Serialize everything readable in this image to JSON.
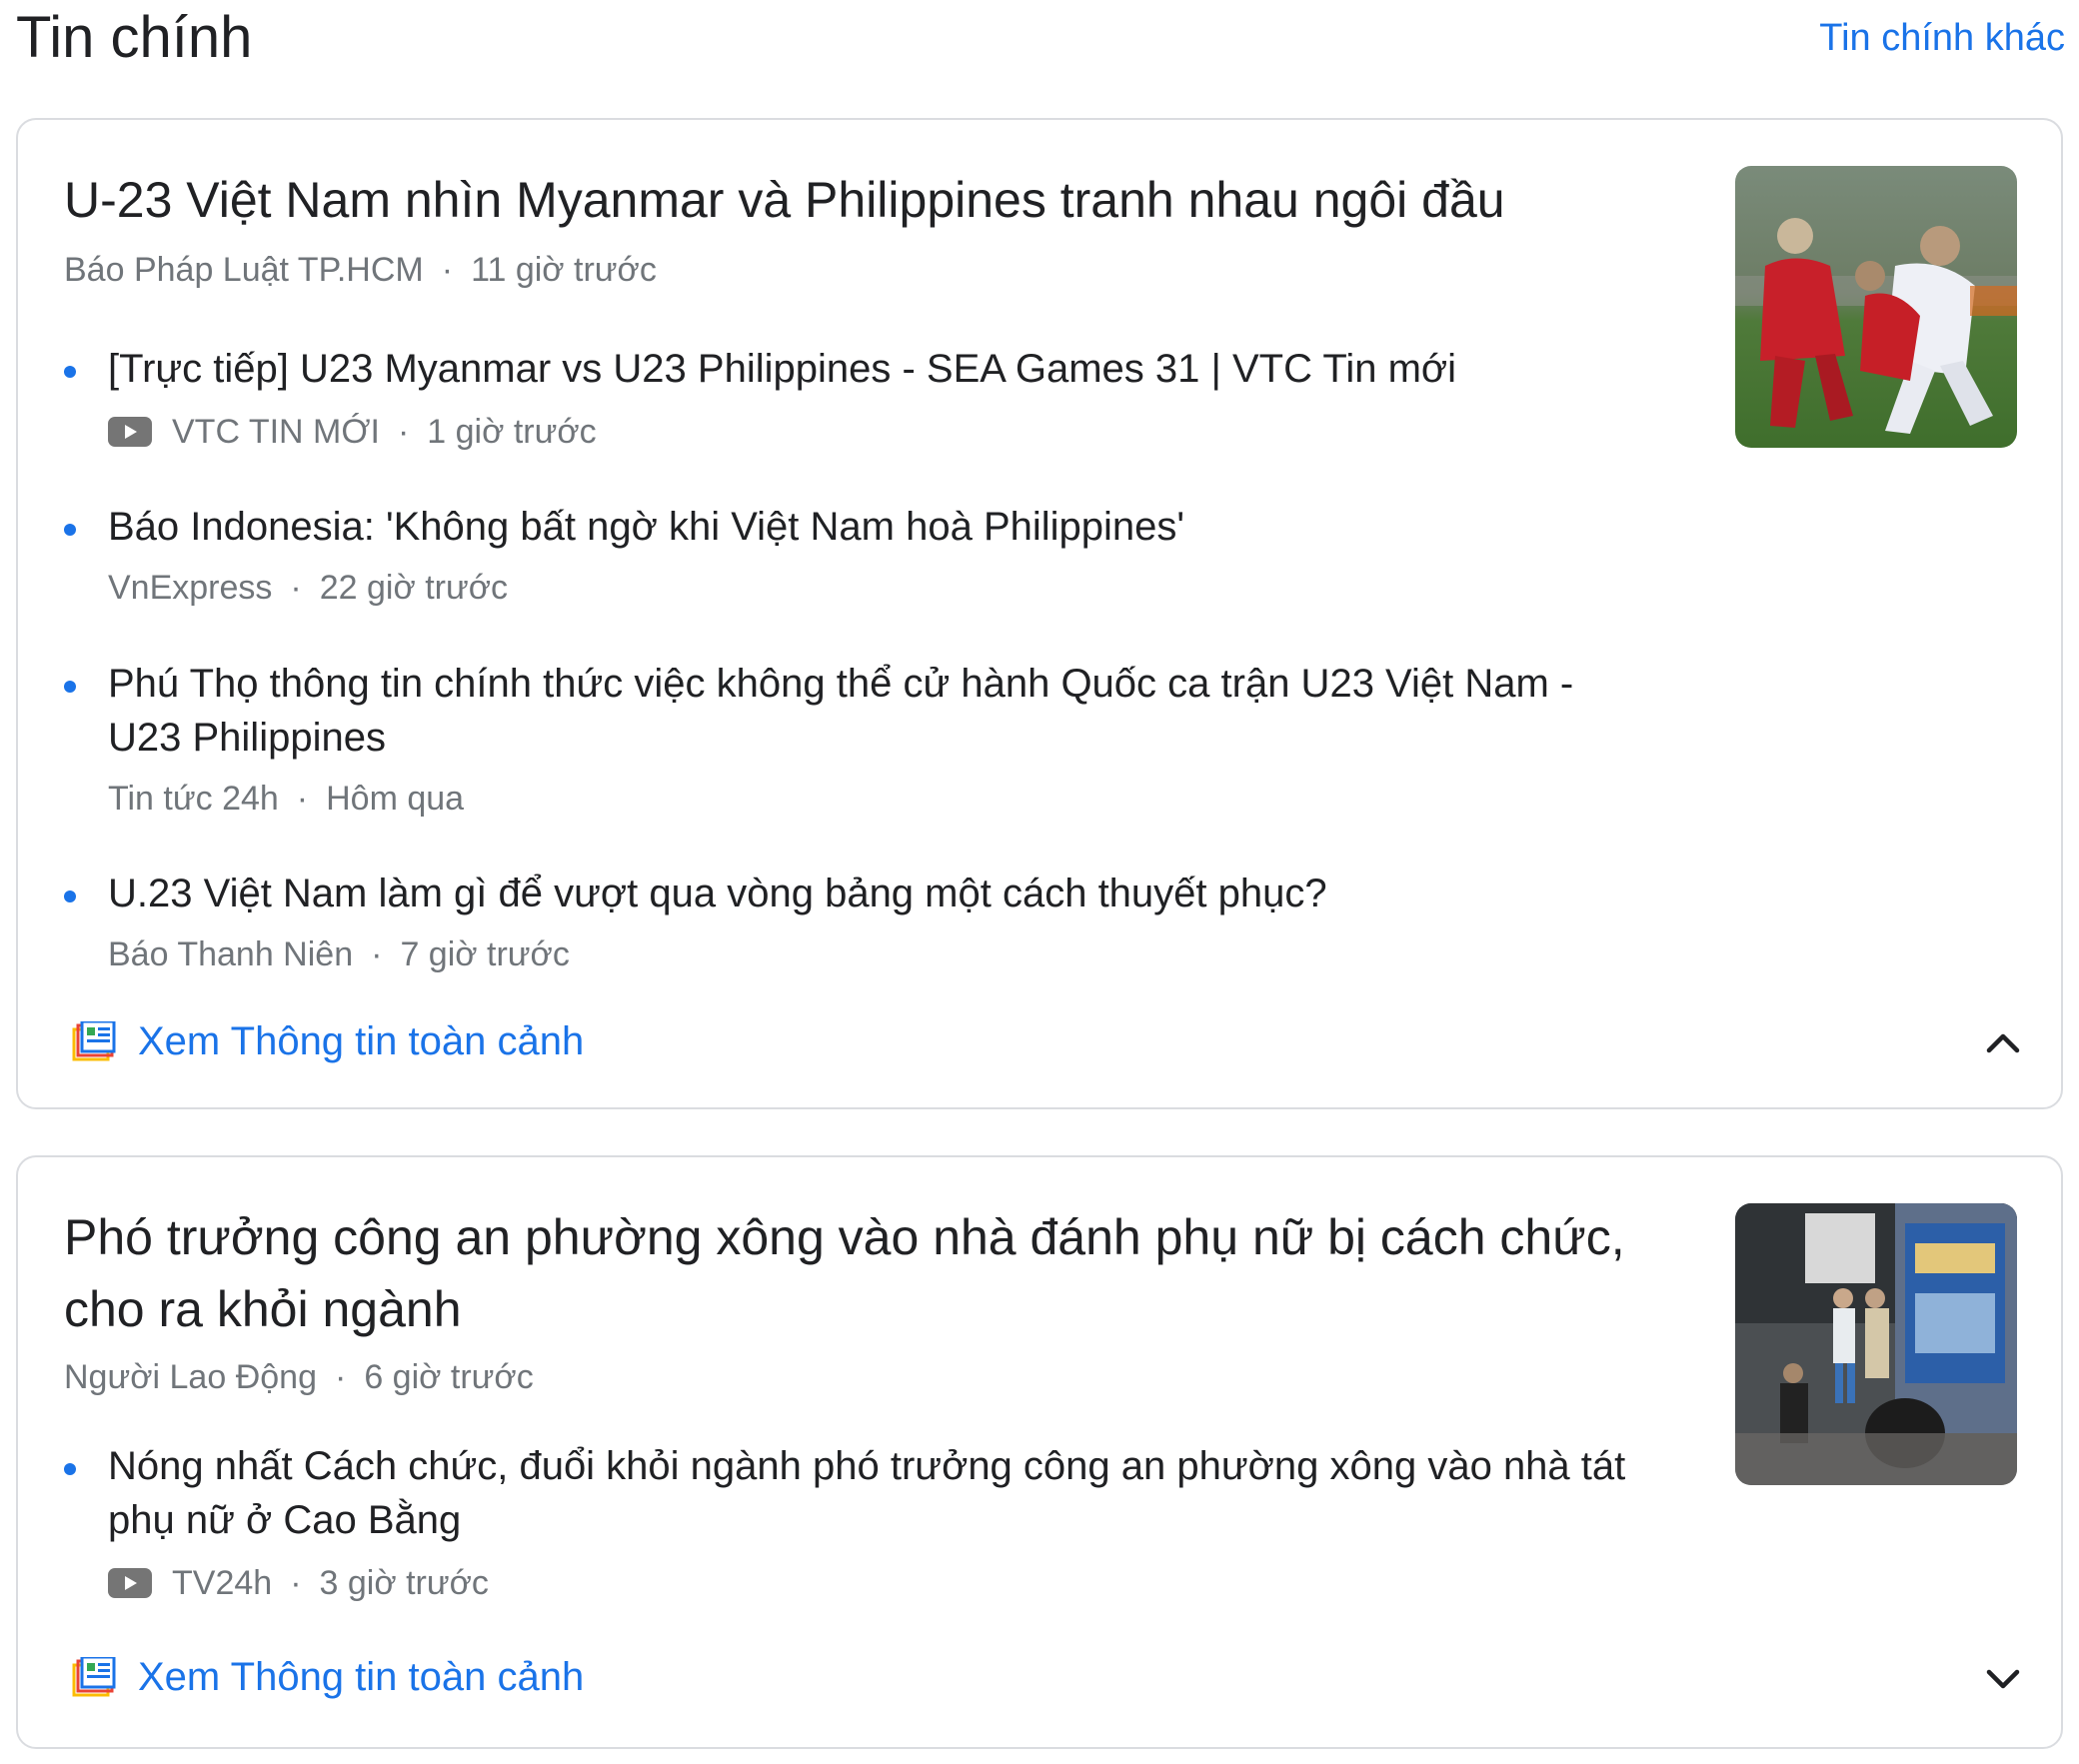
{
  "header": {
    "title": "Tin chính",
    "more_link": "Tin chính khác"
  },
  "stories": [
    {
      "headline": "U-23 Việt Nam nhìn Myanmar và Philippines tranh nhau ngôi đầu",
      "source": "Báo Pháp Luật TP.HCM",
      "time": "11 giờ trước",
      "thumbnail_icon": "soccer-photo",
      "sub_items": [
        {
          "title": "[Trực tiếp] U23 Myanmar vs U23 Philippines - SEA Games 31 | VTC Tin mới",
          "source": "VTC TIN MỚI",
          "time": "1 giờ trước",
          "icon": "youtube-icon"
        },
        {
          "title": "Báo Indonesia: 'Không bất ngờ khi Việt Nam hoà Philippines'",
          "source": "VnExpress",
          "time": "22 giờ trước"
        },
        {
          "title": "Phú Thọ thông tin chính thức việc không thể cử hành Quốc ca trận U23 Việt Nam - U23 Philippines",
          "source": "Tin tức 24h",
          "time": "Hôm qua"
        },
        {
          "title": "U.23 Việt Nam làm gì để vượt qua vòng bảng một cách thuyết phục?",
          "source": "Báo Thanh Niên",
          "time": "7 giờ trước"
        }
      ],
      "full_coverage_label": "Xem Thông tin toàn cảnh",
      "expanded": true,
      "chevron_icon": "chevron-up-icon"
    },
    {
      "headline": "Phó trưởng công an phường xông vào nhà đánh phụ nữ bị cách chức, cho ra khỏi ngành",
      "source": "Người Lao Động",
      "time": "6 giờ trước",
      "thumbnail_icon": "cctv-photo",
      "sub_items": [
        {
          "title": "Nóng nhất Cách chức, đuổi khỏi ngành phó trưởng công an phường xông vào nhà tát phụ nữ ở Cao Bằng",
          "source": "TV24h",
          "time": "3 giờ trước",
          "icon": "youtube-icon"
        }
      ],
      "full_coverage_label": "Xem Thông tin toàn cảnh",
      "expanded": false,
      "chevron_icon": "chevron-down-icon"
    }
  ],
  "colors": {
    "link": "#1a73e8",
    "text": "#202124",
    "meta": "#70757a",
    "border": "#dadce0"
  }
}
